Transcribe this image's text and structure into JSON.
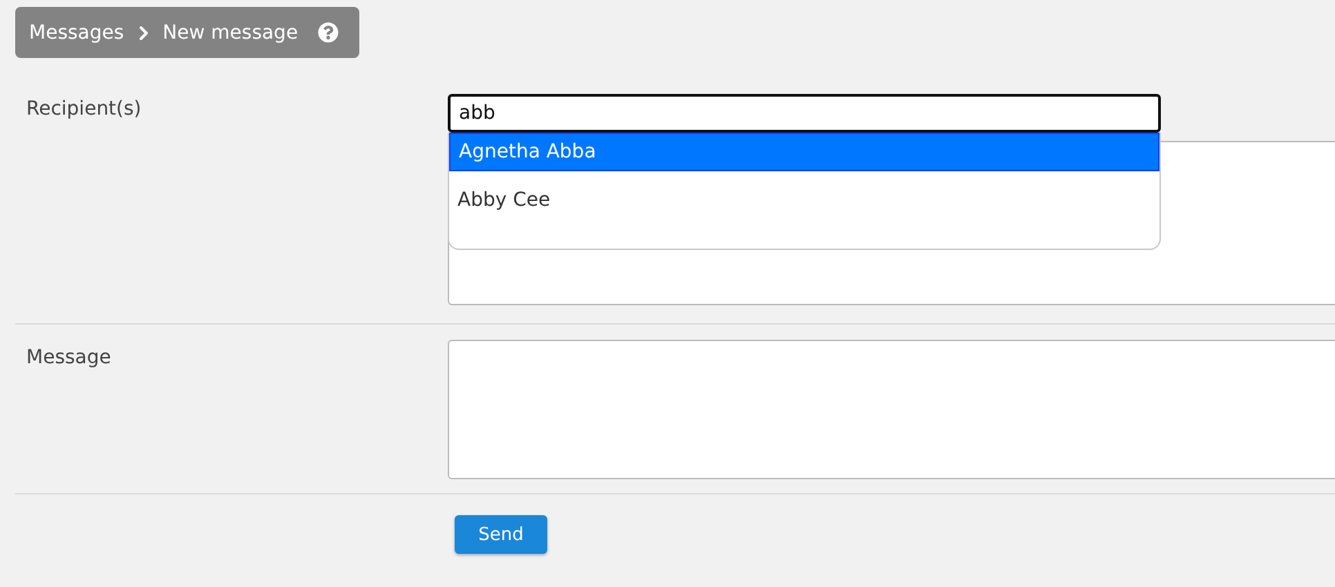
{
  "breadcrumb": {
    "items": [
      "Messages",
      "New message"
    ]
  },
  "form": {
    "recipients": {
      "label": "Recipient(s)",
      "query": "abb",
      "suggestions": [
        {
          "name": "Agnetha Abba",
          "selected": true
        },
        {
          "name": "Abby Cee",
          "selected": false
        }
      ]
    },
    "message": {
      "label": "Message"
    },
    "send_button": "Send"
  }
}
